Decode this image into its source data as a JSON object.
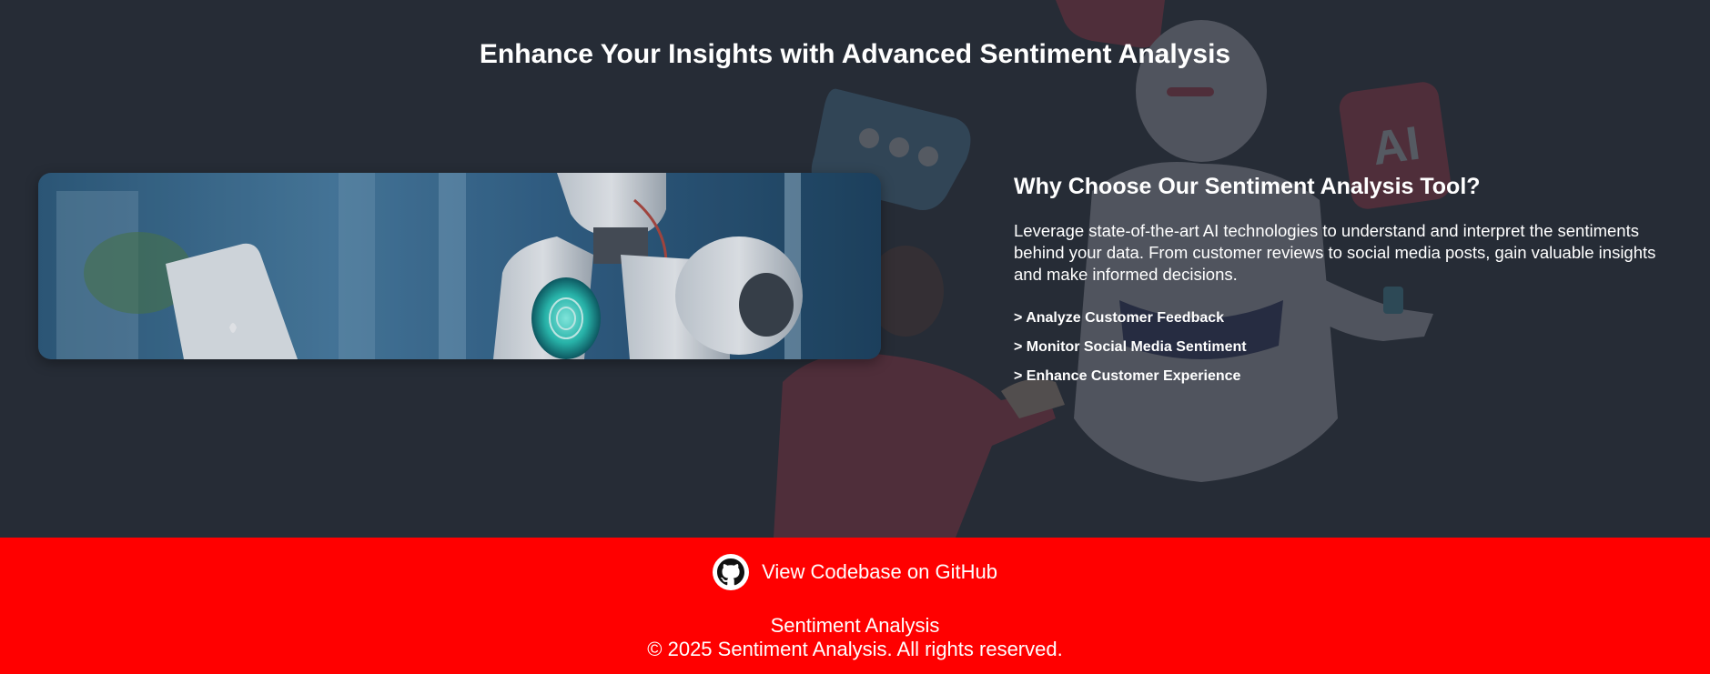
{
  "hero": {
    "title": "Enhance Your Insights with Advanced Sentiment Analysis"
  },
  "info": {
    "title": "Why Choose Our Sentiment Analysis Tool?",
    "description": "Leverage state-of-the-art AI technologies to understand and interpret the sentiments behind your data. From customer reviews to social media posts, gain valuable insights and make informed decisions.",
    "features": [
      "> Analyze Customer Feedback",
      "> Monitor Social Media Sentiment",
      "> Enhance Customer Experience"
    ]
  },
  "footer": {
    "github_label": "View Codebase on GitHub",
    "brand": "Sentiment Analysis",
    "copyright": "© 2025 Sentiment Analysis. All rights reserved."
  },
  "colors": {
    "background": "#262c36",
    "footer": "#ff0000",
    "text": "#ffffff"
  },
  "icons": {
    "github": "github-icon"
  }
}
